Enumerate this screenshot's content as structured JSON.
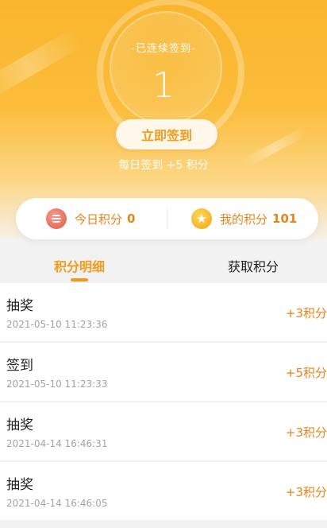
{
  "header": {
    "streak_label": "-已连续签到-",
    "streak_count": "1",
    "signin_button": "立即签到",
    "daily_hint": "每日签到 +5 积分"
  },
  "points": {
    "today_label": "今日积分",
    "today_value": "0",
    "mine_label": "我的积分",
    "mine_value": "101"
  },
  "tabs": [
    {
      "label": "积分明细",
      "active": true
    },
    {
      "label": "获取积分",
      "active": false
    }
  ],
  "records": [
    {
      "title": "抽奖",
      "time": "2021-05-10 11:23:36",
      "points": "+3积分"
    },
    {
      "title": "签到",
      "time": "2021-05-10 11:23:33",
      "points": "+5积分"
    },
    {
      "title": "抽奖",
      "time": "2021-04-14 16:46:31",
      "points": "+3积分"
    },
    {
      "title": "抽奖",
      "time": "2021-04-14 16:46:05",
      "points": "+3积分"
    }
  ],
  "colors": {
    "accent": "#f39a1b",
    "hero_top": "#f9b52c",
    "muted_text": "#a3a3a3"
  },
  "icons": {
    "today": "coin-stack-icon",
    "mine": "star-icon"
  }
}
